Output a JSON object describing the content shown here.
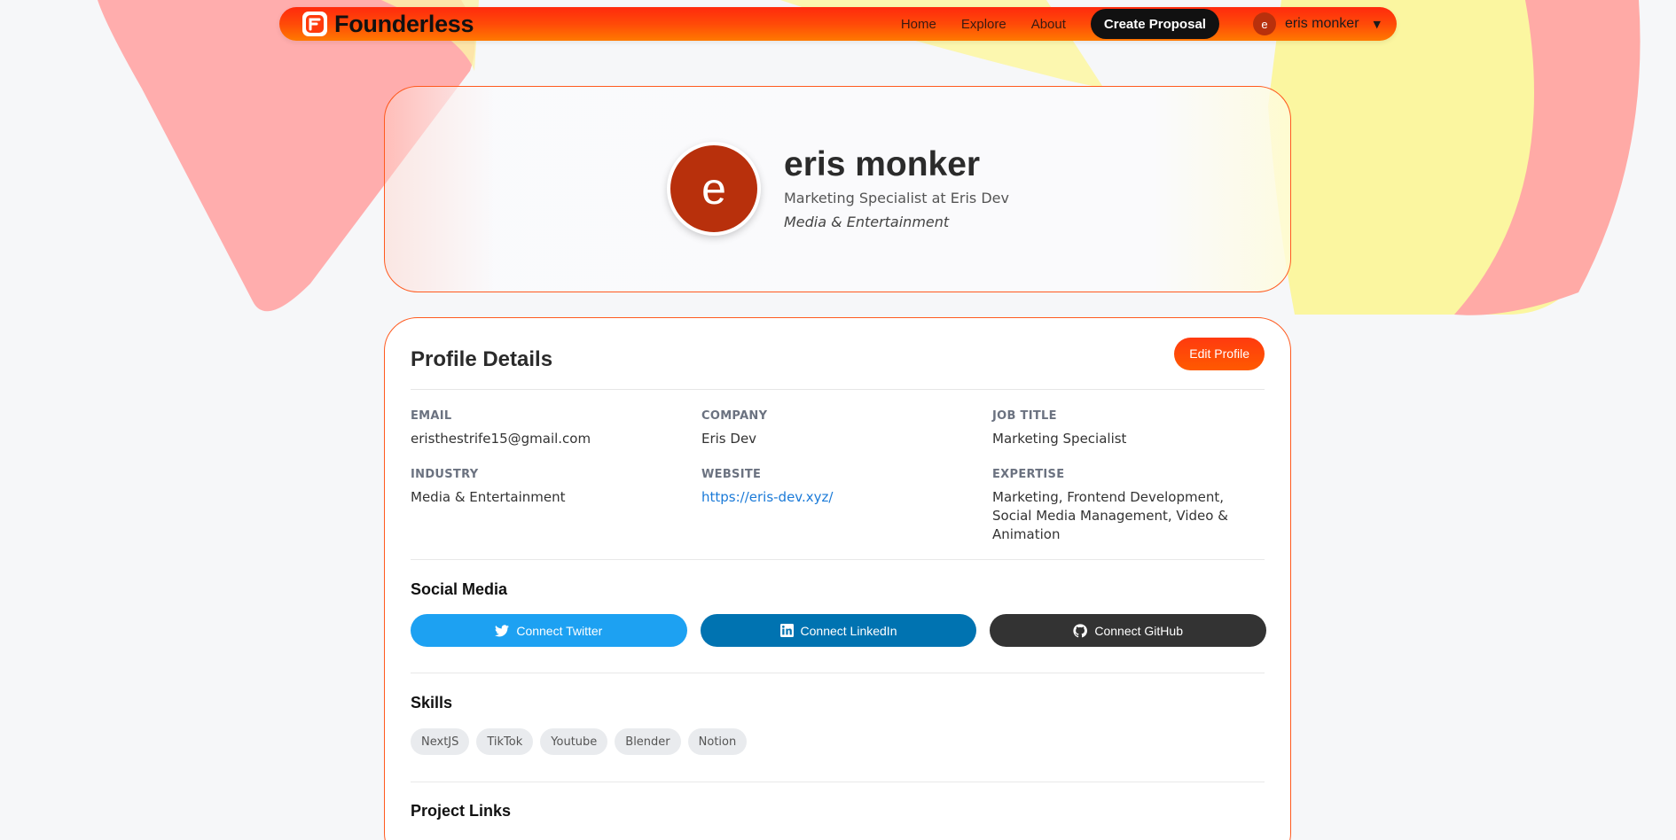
{
  "nav": {
    "brand": "Founderless",
    "links": [
      "Home",
      "Explore",
      "About"
    ],
    "create_label": "Create Proposal",
    "user_initial": "e",
    "user_name": "eris monker",
    "caret": "▼"
  },
  "profile": {
    "initial": "e",
    "name": "eris monker",
    "subtitle": "Marketing Specialist at Eris Dev",
    "industry": "Media & Entertainment"
  },
  "details": {
    "title": "Profile Details",
    "edit_label": "Edit Profile",
    "fields": [
      {
        "label": "EMAIL",
        "value": "eristhestrife15@gmail.com"
      },
      {
        "label": "COMPANY",
        "value": "Eris Dev"
      },
      {
        "label": "JOB TITLE",
        "value": "Marketing Specialist"
      },
      {
        "label": "INDUSTRY",
        "value": "Media & Entertainment"
      },
      {
        "label": "WEBSITE",
        "value": "https://eris-dev.xyz/"
      },
      {
        "label": "EXPERTISE",
        "value": "Marketing, Frontend Development, Social Media Management, Video & Animation"
      }
    ]
  },
  "social": {
    "title": "Social Media",
    "twitter": "Connect Twitter",
    "linkedin": "Connect LinkedIn",
    "github": "Connect GitHub"
  },
  "skills": {
    "title": "Skills",
    "items": [
      "NextJS",
      "TikTok",
      "Youtube",
      "Blender",
      "Notion"
    ]
  },
  "projects": {
    "title": "Project Links"
  },
  "colors": {
    "accent": "#ff4a08",
    "avatar": "#b8300c",
    "twitter": "#1da1f2",
    "linkedin": "#0073b1",
    "github": "#333333",
    "link": "#1a7ad8"
  },
  "icons": {
    "twitter": "twitter-icon",
    "linkedin": "linkedin-icon",
    "github": "github-icon",
    "logo": "founderless-logo-icon"
  }
}
